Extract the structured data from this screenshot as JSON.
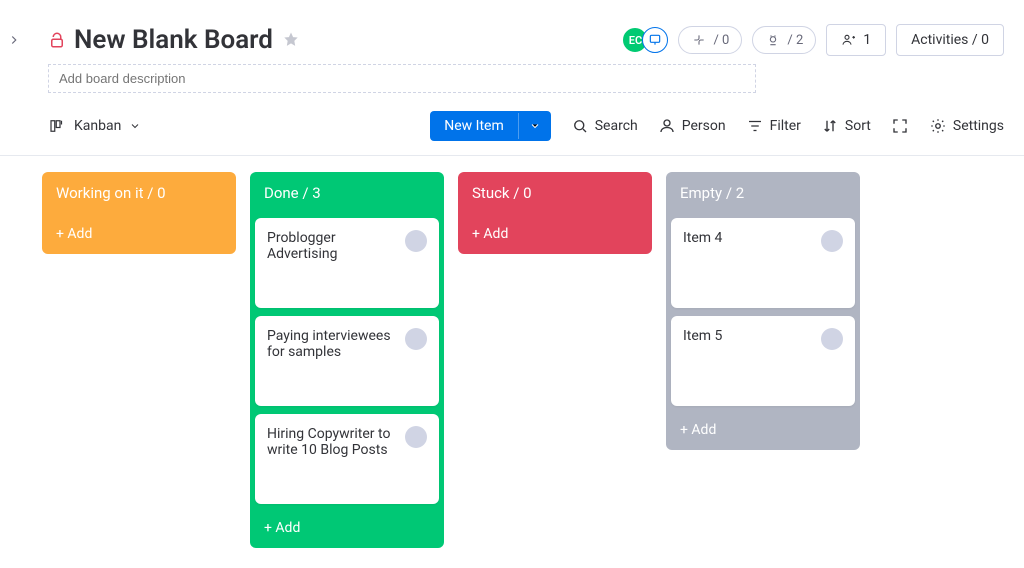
{
  "header": {
    "board_title": "New Blank Board",
    "description_placeholder": "Add board description",
    "avatar1_initials": "EC",
    "integration_count": "/ 0",
    "automation_count": "/ 2",
    "members_count": "1",
    "activities_label": "Activities / 0"
  },
  "toolbar": {
    "view_label": "Kanban",
    "new_item_label": "New Item",
    "search_label": "Search",
    "person_label": "Person",
    "filter_label": "Filter",
    "sort_label": "Sort",
    "settings_label": "Settings"
  },
  "columns": [
    {
      "title": "Working on it / 0",
      "color": "c-orange",
      "add_label": "+ Add",
      "cards": []
    },
    {
      "title": "Done / 3",
      "color": "c-green",
      "add_label": "+ Add",
      "cards": [
        {
          "title": "Problogger Advertising"
        },
        {
          "title": "Paying interviewees for samples"
        },
        {
          "title": "Hiring Copywriter to write 10 Blog Posts"
        }
      ]
    },
    {
      "title": "Stuck / 0",
      "color": "c-red",
      "add_label": "+ Add",
      "cards": []
    },
    {
      "title": "Empty / 2",
      "color": "c-grey",
      "add_label": "+ Add",
      "cards": [
        {
          "title": "Item 4"
        },
        {
          "title": "Item 5"
        }
      ]
    }
  ]
}
